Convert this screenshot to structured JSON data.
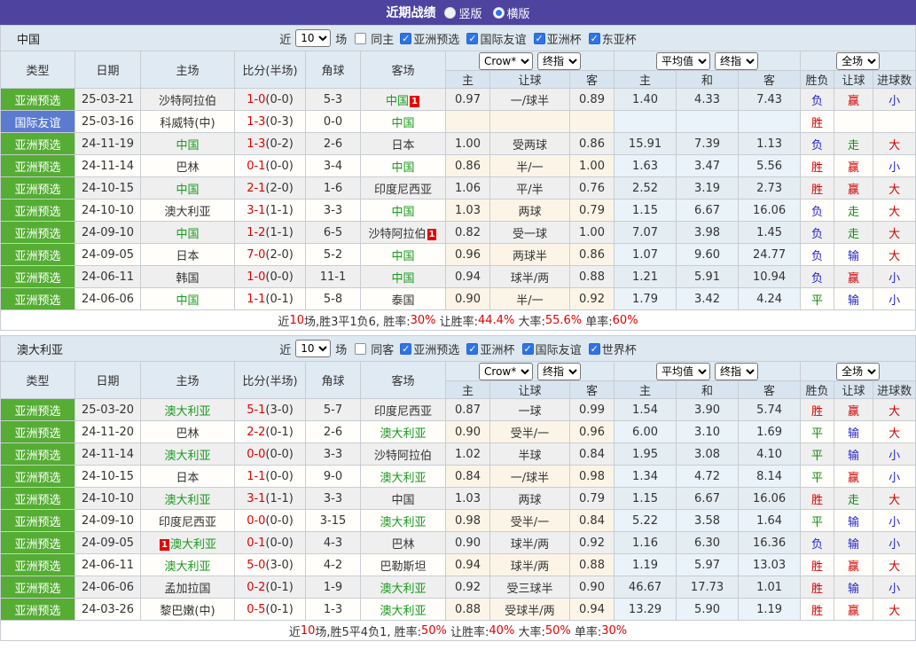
{
  "colors": {
    "header_purple": "#4e44a0",
    "section_bar_bg": "#dee8f0",
    "badge_green": "#55ad33",
    "badge_blue": "#5b7bd0",
    "focus_team_green": "#1a9a1e",
    "score_red": "#e10000",
    "red_card_badge": "#e80000",
    "result_win_red": "#d40000",
    "result_lose_blue": "#2525cc",
    "result_draw_green": "#148a14",
    "checkbox_blue": "#2e74e8"
  },
  "title_bar": {
    "title": "近期战绩",
    "vertical_label": "竖版",
    "horizontal_label": "横版"
  },
  "columns": {
    "type": "类型",
    "date": "日期",
    "home": "主场",
    "score": "比分(半场)",
    "corner": "角球",
    "away": "客场",
    "odds_sub": [
      "主",
      "让球",
      "客"
    ],
    "avg_sub": [
      "主",
      "和",
      "客"
    ],
    "result_sub": [
      "胜负",
      "让球",
      "进球数"
    ]
  },
  "sections": [
    {
      "team": "中国",
      "filter": {
        "near": "近",
        "games": "10",
        "games_unit": "场",
        "same": "同主",
        "cups": [
          {
            "label": "亚洲预选"
          },
          {
            "label": "国际友谊"
          },
          {
            "label": "亚洲杯"
          },
          {
            "label": "东亚杯"
          }
        ]
      },
      "selects": {
        "odds_source": "Crow*",
        "odds_final": "终指",
        "avg_source": "平均值",
        "avg_final": "终指",
        "scope": "全场"
      },
      "rows": [
        {
          "type": "亚洲预选",
          "tclass": "t-green",
          "date": "25-03-21",
          "home": "沙特阿拉伯",
          "hclass": "",
          "hcard": "",
          "score_ft": "1-0",
          "score_ht": "(0-0)",
          "corner": "5-3",
          "away": "中国",
          "aclass": "focus",
          "acard": "1",
          "odds": [
            "0.97",
            "一/球半",
            "0.89"
          ],
          "avg": [
            "1.40",
            "4.33",
            "7.43"
          ],
          "results": [
            {
              "t": "负",
              "c": "blue"
            },
            {
              "t": "赢",
              "c": "red"
            },
            {
              "t": "小",
              "c": "blue"
            }
          ]
        },
        {
          "type": "国际友谊",
          "tclass": "t-blue",
          "date": "25-03-16",
          "home": "科威特(中)",
          "hclass": "",
          "hcard": "",
          "score_ft": "1-3",
          "score_ht": "(0-3)",
          "corner": "0-0",
          "away": "中国",
          "aclass": "focus",
          "acard": "",
          "odds": [
            "",
            "",
            ""
          ],
          "avg": [
            "",
            "",
            ""
          ],
          "results": [
            {
              "t": "胜",
              "c": "red"
            },
            {
              "t": "",
              "c": ""
            },
            {
              "t": "",
              "c": ""
            }
          ]
        },
        {
          "type": "亚洲预选",
          "tclass": "t-green",
          "date": "24-11-19",
          "home": "中国",
          "hclass": "focus",
          "hcard": "",
          "score_ft": "1-3",
          "score_ht": "(0-2)",
          "corner": "2-6",
          "away": "日本",
          "aclass": "",
          "acard": "",
          "odds": [
            "1.00",
            "受两球",
            "0.86"
          ],
          "avg": [
            "15.91",
            "7.39",
            "1.13"
          ],
          "results": [
            {
              "t": "负",
              "c": "blue"
            },
            {
              "t": "走",
              "c": "green"
            },
            {
              "t": "大",
              "c": "red"
            }
          ]
        },
        {
          "type": "亚洲预选",
          "tclass": "t-green",
          "date": "24-11-14",
          "home": "巴林",
          "hclass": "",
          "hcard": "",
          "score_ft": "0-1",
          "score_ht": "(0-0)",
          "corner": "3-4",
          "away": "中国",
          "aclass": "focus",
          "acard": "",
          "odds": [
            "0.86",
            "半/一",
            "1.00"
          ],
          "avg": [
            "1.63",
            "3.47",
            "5.56"
          ],
          "results": [
            {
              "t": "胜",
              "c": "red"
            },
            {
              "t": "赢",
              "c": "red"
            },
            {
              "t": "小",
              "c": "blue"
            }
          ]
        },
        {
          "type": "亚洲预选",
          "tclass": "t-green",
          "date": "24-10-15",
          "home": "中国",
          "hclass": "focus",
          "hcard": "",
          "score_ft": "2-1",
          "score_ht": "(2-0)",
          "corner": "1-6",
          "away": "印度尼西亚",
          "aclass": "",
          "acard": "",
          "odds": [
            "1.06",
            "平/半",
            "0.76"
          ],
          "avg": [
            "2.52",
            "3.19",
            "2.73"
          ],
          "results": [
            {
              "t": "胜",
              "c": "red"
            },
            {
              "t": "赢",
              "c": "red"
            },
            {
              "t": "大",
              "c": "red"
            }
          ]
        },
        {
          "type": "亚洲预选",
          "tclass": "t-green",
          "date": "24-10-10",
          "home": "澳大利亚",
          "hclass": "",
          "hcard": "",
          "score_ft": "3-1",
          "score_ht": "(1-1)",
          "corner": "3-3",
          "away": "中国",
          "aclass": "focus",
          "acard": "",
          "odds": [
            "1.03",
            "两球",
            "0.79"
          ],
          "avg": [
            "1.15",
            "6.67",
            "16.06"
          ],
          "results": [
            {
              "t": "负",
              "c": "blue"
            },
            {
              "t": "走",
              "c": "green"
            },
            {
              "t": "大",
              "c": "red"
            }
          ]
        },
        {
          "type": "亚洲预选",
          "tclass": "t-green",
          "date": "24-09-10",
          "home": "中国",
          "hclass": "focus",
          "hcard": "",
          "score_ft": "1-2",
          "score_ht": "(1-1)",
          "corner": "6-5",
          "away": "沙特阿拉伯",
          "aclass": "",
          "acard": "1",
          "odds": [
            "0.82",
            "受一球",
            "1.00"
          ],
          "avg": [
            "7.07",
            "3.98",
            "1.45"
          ],
          "results": [
            {
              "t": "负",
              "c": "blue"
            },
            {
              "t": "走",
              "c": "green"
            },
            {
              "t": "大",
              "c": "red"
            }
          ]
        },
        {
          "type": "亚洲预选",
          "tclass": "t-green",
          "date": "24-09-05",
          "home": "日本",
          "hclass": "",
          "hcard": "",
          "score_ft": "7-0",
          "score_ht": "(2-0)",
          "corner": "5-2",
          "away": "中国",
          "aclass": "focus",
          "acard": "",
          "odds": [
            "0.96",
            "两球半",
            "0.86"
          ],
          "avg": [
            "1.07",
            "9.60",
            "24.77"
          ],
          "results": [
            {
              "t": "负",
              "c": "blue"
            },
            {
              "t": "输",
              "c": "blue"
            },
            {
              "t": "大",
              "c": "red"
            }
          ]
        },
        {
          "type": "亚洲预选",
          "tclass": "t-green",
          "date": "24-06-11",
          "home": "韩国",
          "hclass": "",
          "hcard": "",
          "score_ft": "1-0",
          "score_ht": "(0-0)",
          "corner": "11-1",
          "away": "中国",
          "aclass": "focus",
          "acard": "",
          "odds": [
            "0.94",
            "球半/两",
            "0.88"
          ],
          "avg": [
            "1.21",
            "5.91",
            "10.94"
          ],
          "results": [
            {
              "t": "负",
              "c": "blue"
            },
            {
              "t": "赢",
              "c": "red"
            },
            {
              "t": "小",
              "c": "blue"
            }
          ]
        },
        {
          "type": "亚洲预选",
          "tclass": "t-green",
          "date": "24-06-06",
          "home": "中国",
          "hclass": "focus",
          "hcard": "",
          "score_ft": "1-1",
          "score_ht": "(0-1)",
          "corner": "5-8",
          "away": "泰国",
          "aclass": "",
          "acard": "",
          "odds": [
            "0.90",
            "半/一",
            "0.92"
          ],
          "avg": [
            "1.79",
            "3.42",
            "4.24"
          ],
          "results": [
            {
              "t": "平",
              "c": "green"
            },
            {
              "t": "输",
              "c": "blue"
            },
            {
              "t": "小",
              "c": "blue"
            }
          ]
        }
      ],
      "summary": [
        {
          "t": "近",
          "c": "k"
        },
        {
          "t": "10",
          "c": "r"
        },
        {
          "t": "场,胜3平1负6, 胜率:",
          "c": "k"
        },
        {
          "t": "30%",
          "c": "r"
        },
        {
          "t": " 让胜率:",
          "c": "k"
        },
        {
          "t": "44.4%",
          "c": "r"
        },
        {
          "t": " 大率:",
          "c": "k"
        },
        {
          "t": "55.6%",
          "c": "r"
        },
        {
          "t": " 单率:",
          "c": "k"
        },
        {
          "t": "60%",
          "c": "r"
        }
      ]
    },
    {
      "team": "澳大利亚",
      "filter": {
        "near": "近",
        "games": "10",
        "games_unit": "场",
        "same": "同客",
        "cups": [
          {
            "label": "亚洲预选"
          },
          {
            "label": "亚洲杯"
          },
          {
            "label": "国际友谊"
          },
          {
            "label": "世界杯"
          }
        ]
      },
      "selects": {
        "odds_source": "Crow*",
        "odds_final": "终指",
        "avg_source": "平均值",
        "avg_final": "终指",
        "scope": "全场"
      },
      "rows": [
        {
          "type": "亚洲预选",
          "tclass": "t-green",
          "date": "25-03-20",
          "home": "澳大利亚",
          "hclass": "focus",
          "hcard": "",
          "score_ft": "5-1",
          "score_ht": "(3-0)",
          "corner": "5-7",
          "away": "印度尼西亚",
          "aclass": "",
          "acard": "",
          "odds": [
            "0.87",
            "一球",
            "0.99"
          ],
          "avg": [
            "1.54",
            "3.90",
            "5.74"
          ],
          "results": [
            {
              "t": "胜",
              "c": "red"
            },
            {
              "t": "赢",
              "c": "red"
            },
            {
              "t": "大",
              "c": "red"
            }
          ]
        },
        {
          "type": "亚洲预选",
          "tclass": "t-green",
          "date": "24-11-20",
          "home": "巴林",
          "hclass": "",
          "hcard": "",
          "score_ft": "2-2",
          "score_ht": "(0-1)",
          "corner": "2-6",
          "away": "澳大利亚",
          "aclass": "focus",
          "acard": "",
          "odds": [
            "0.90",
            "受半/一",
            "0.96"
          ],
          "avg": [
            "6.00",
            "3.10",
            "1.69"
          ],
          "results": [
            {
              "t": "平",
              "c": "green"
            },
            {
              "t": "输",
              "c": "blue"
            },
            {
              "t": "大",
              "c": "red"
            }
          ]
        },
        {
          "type": "亚洲预选",
          "tclass": "t-green",
          "date": "24-11-14",
          "home": "澳大利亚",
          "hclass": "focus",
          "hcard": "",
          "score_ft": "0-0",
          "score_ht": "(0-0)",
          "corner": "3-3",
          "away": "沙特阿拉伯",
          "aclass": "",
          "acard": "",
          "odds": [
            "1.02",
            "半球",
            "0.84"
          ],
          "avg": [
            "1.95",
            "3.08",
            "4.10"
          ],
          "results": [
            {
              "t": "平",
              "c": "green"
            },
            {
              "t": "输",
              "c": "blue"
            },
            {
              "t": "小",
              "c": "blue"
            }
          ]
        },
        {
          "type": "亚洲预选",
          "tclass": "t-green",
          "date": "24-10-15",
          "home": "日本",
          "hclass": "",
          "hcard": "",
          "score_ft": "1-1",
          "score_ht": "(0-0)",
          "corner": "9-0",
          "away": "澳大利亚",
          "aclass": "focus",
          "acard": "",
          "odds": [
            "0.84",
            "一/球半",
            "0.98"
          ],
          "avg": [
            "1.34",
            "4.72",
            "8.14"
          ],
          "results": [
            {
              "t": "平",
              "c": "green"
            },
            {
              "t": "赢",
              "c": "red"
            },
            {
              "t": "小",
              "c": "blue"
            }
          ]
        },
        {
          "type": "亚洲预选",
          "tclass": "t-green",
          "date": "24-10-10",
          "home": "澳大利亚",
          "hclass": "focus",
          "hcard": "",
          "score_ft": "3-1",
          "score_ht": "(1-1)",
          "corner": "3-3",
          "away": "中国",
          "aclass": "",
          "acard": "",
          "odds": [
            "1.03",
            "两球",
            "0.79"
          ],
          "avg": [
            "1.15",
            "6.67",
            "16.06"
          ],
          "results": [
            {
              "t": "胜",
              "c": "red"
            },
            {
              "t": "走",
              "c": "green"
            },
            {
              "t": "大",
              "c": "red"
            }
          ]
        },
        {
          "type": "亚洲预选",
          "tclass": "t-green",
          "date": "24-09-10",
          "home": "印度尼西亚",
          "hclass": "",
          "hcard": "",
          "score_ft": "0-0",
          "score_ht": "(0-0)",
          "corner": "3-15",
          "away": "澳大利亚",
          "aclass": "focus",
          "acard": "",
          "odds": [
            "0.98",
            "受半/一",
            "0.84"
          ],
          "avg": [
            "5.22",
            "3.58",
            "1.64"
          ],
          "results": [
            {
              "t": "平",
              "c": "green"
            },
            {
              "t": "输",
              "c": "blue"
            },
            {
              "t": "小",
              "c": "blue"
            }
          ]
        },
        {
          "type": "亚洲预选",
          "tclass": "t-green",
          "date": "24-09-05",
          "home": "澳大利亚",
          "hclass": "focus",
          "hcard": "1",
          "score_ft": "0-1",
          "score_ht": "(0-0)",
          "corner": "4-3",
          "away": "巴林",
          "aclass": "",
          "acard": "",
          "odds": [
            "0.90",
            "球半/两",
            "0.92"
          ],
          "avg": [
            "1.16",
            "6.30",
            "16.36"
          ],
          "results": [
            {
              "t": "负",
              "c": "blue"
            },
            {
              "t": "输",
              "c": "blue"
            },
            {
              "t": "小",
              "c": "blue"
            }
          ]
        },
        {
          "type": "亚洲预选",
          "tclass": "t-green",
          "date": "24-06-11",
          "home": "澳大利亚",
          "hclass": "focus",
          "hcard": "",
          "score_ft": "5-0",
          "score_ht": "(3-0)",
          "corner": "4-2",
          "away": "巴勒斯坦",
          "aclass": "",
          "acard": "",
          "odds": [
            "0.94",
            "球半/两",
            "0.88"
          ],
          "avg": [
            "1.19",
            "5.97",
            "13.03"
          ],
          "results": [
            {
              "t": "胜",
              "c": "red"
            },
            {
              "t": "赢",
              "c": "red"
            },
            {
              "t": "大",
              "c": "red"
            }
          ]
        },
        {
          "type": "亚洲预选",
          "tclass": "t-green",
          "date": "24-06-06",
          "home": "孟加拉国",
          "hclass": "",
          "hcard": "",
          "score_ft": "0-2",
          "score_ht": "(0-1)",
          "corner": "1-9",
          "away": "澳大利亚",
          "aclass": "focus",
          "acard": "",
          "odds": [
            "0.92",
            "受三球半",
            "0.90"
          ],
          "avg": [
            "46.67",
            "17.73",
            "1.01"
          ],
          "results": [
            {
              "t": "胜",
              "c": "red"
            },
            {
              "t": "输",
              "c": "blue"
            },
            {
              "t": "小",
              "c": "blue"
            }
          ]
        },
        {
          "type": "亚洲预选",
          "tclass": "t-green",
          "date": "24-03-26",
          "home": "黎巴嫩(中)",
          "hclass": "",
          "hcard": "",
          "score_ft": "0-5",
          "score_ht": "(0-1)",
          "corner": "1-3",
          "away": "澳大利亚",
          "aclass": "focus",
          "acard": "",
          "odds": [
            "0.88",
            "受球半/两",
            "0.94"
          ],
          "avg": [
            "13.29",
            "5.90",
            "1.19"
          ],
          "results": [
            {
              "t": "胜",
              "c": "red"
            },
            {
              "t": "赢",
              "c": "red"
            },
            {
              "t": "大",
              "c": "red"
            }
          ]
        }
      ],
      "summary": [
        {
          "t": "近",
          "c": "k"
        },
        {
          "t": "10",
          "c": "r"
        },
        {
          "t": "场,胜5平4负1, 胜率:",
          "c": "k"
        },
        {
          "t": "50%",
          "c": "r"
        },
        {
          "t": " 让胜率:",
          "c": "k"
        },
        {
          "t": "40%",
          "c": "r"
        },
        {
          "t": " 大率:",
          "c": "k"
        },
        {
          "t": "50%",
          "c": "r"
        },
        {
          "t": " 单率:",
          "c": "k"
        },
        {
          "t": "30%",
          "c": "r"
        }
      ]
    }
  ]
}
